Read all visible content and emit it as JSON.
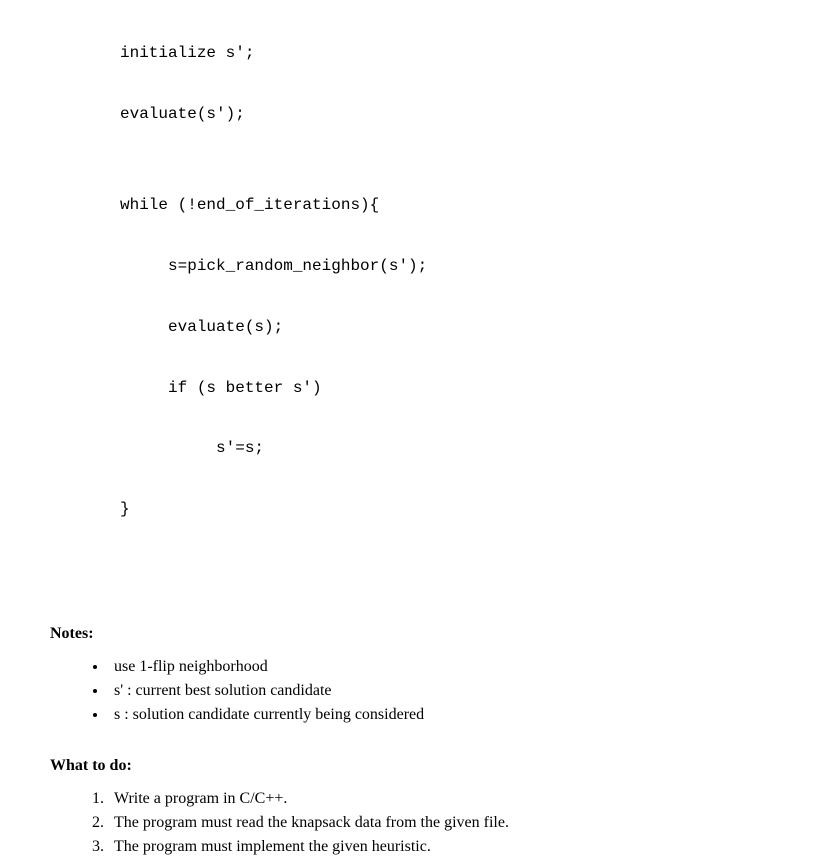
{
  "code": {
    "line1": "initialize s';",
    "line2": "evaluate(s');",
    "line3": "",
    "line4": "while (!end_of_iterations){",
    "line5": "     s=pick_random_neighbor(s');",
    "line6": "     evaluate(s);",
    "line7": "     if (s better s')",
    "line8": "          s'=s;",
    "line9": "}"
  },
  "notes": {
    "heading": "Notes:",
    "items": [
      "use 1-flip neighborhood",
      "s'  : current best solution candidate",
      "s  : solution candidate currently being considered"
    ]
  },
  "what_to_do": {
    "heading": "What to do:",
    "items": [
      "Write a program in C/C++.",
      "The program must read the knapsack data from the given file.",
      "The program must implement the given heuristic."
    ]
  }
}
